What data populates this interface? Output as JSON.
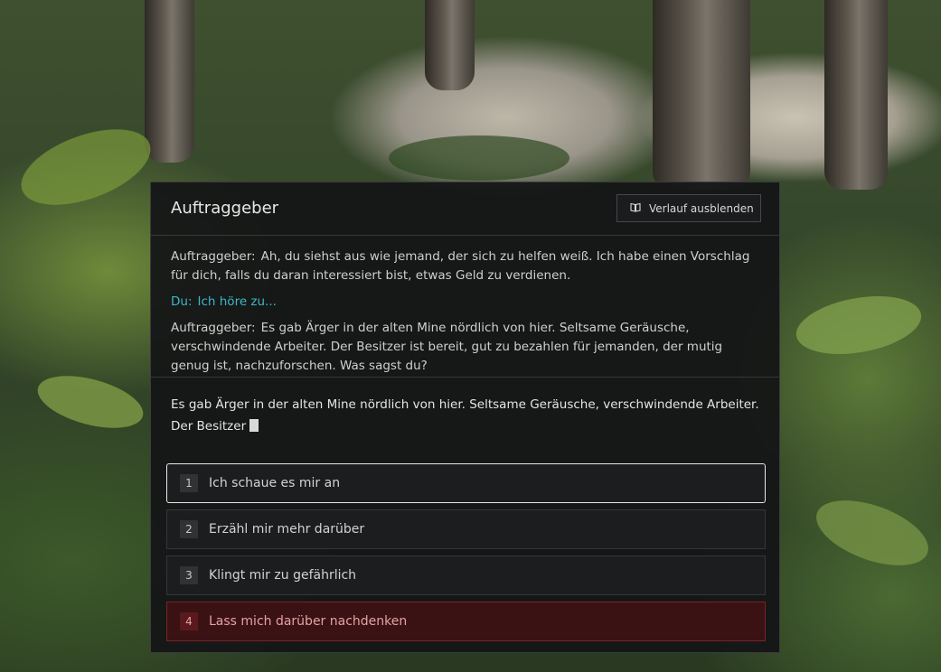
{
  "dialog": {
    "title": "Auftraggeber",
    "history_toggle_label": "Verlauf ausblenden",
    "history": [
      {
        "speaker": "Auftraggeber:",
        "text": "Ah, du siehst aus wie jemand, der sich zu helfen weiß. Ich habe einen Vorschlag für dich, falls du daran interessiert bist, etwas Geld zu verdienen.",
        "type": "npc"
      },
      {
        "speaker": "Du:",
        "text": "Ich höre zu...",
        "type": "player"
      },
      {
        "speaker": "Auftraggeber:",
        "text": "Es gab Ärger in der alten Mine nördlich von hier. Seltsame Geräusche, verschwindende Arbeiter. Der Besitzer ist bereit, gut zu bezahlen für jemanden, der mutig genug ist, nachzuforschen. Was sagst du?",
        "type": "npc"
      }
    ],
    "current_line": "Es gab Ärger in der alten Mine nördlich von hier. Seltsame Geräusche, verschwindende Arbeiter. Der Besitzer",
    "options": [
      {
        "number": "1",
        "label": "Ich schaue es mir an",
        "state": "selected"
      },
      {
        "number": "2",
        "label": "Erzähl mir mehr darüber",
        "state": "normal"
      },
      {
        "number": "3",
        "label": "Klingt mir zu gefährlich",
        "state": "normal"
      },
      {
        "number": "4",
        "label": "Lass mich darüber nachdenken",
        "state": "danger"
      }
    ]
  },
  "icons": {
    "history_toggle": "book-icon"
  },
  "colors": {
    "player_text": "#3bb7c9",
    "danger_option": "#7a2226"
  }
}
